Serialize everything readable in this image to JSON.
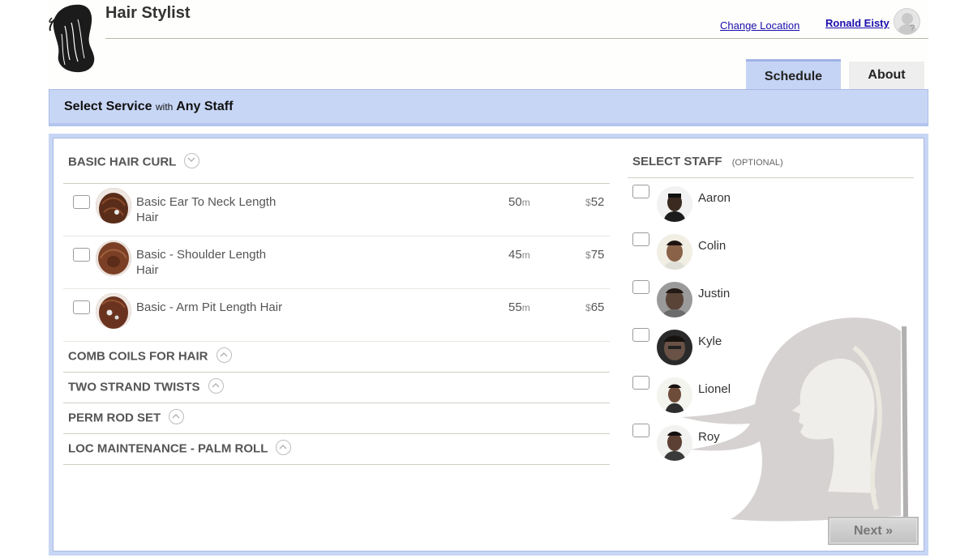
{
  "header": {
    "app_title": "Hair Stylist",
    "change_location_label": "Change Location",
    "user_name": "Ronald Eisty"
  },
  "tabs": [
    {
      "label": "Schedule",
      "active": true
    },
    {
      "label": "About",
      "active": false
    }
  ],
  "service_bar": {
    "prefix": "Select Service",
    "connector": "with",
    "staff": "Any Staff"
  },
  "categories": [
    {
      "name": "BASIC HAIR CURL",
      "expanded": true,
      "services": [
        {
          "name": "Basic Ear To Neck Length Hair",
          "duration": "50",
          "duration_unit": "m",
          "currency": "$",
          "price": "52"
        },
        {
          "name": "Basic - Shoulder Length Hair",
          "duration": "45",
          "duration_unit": "m",
          "currency": "$",
          "price": "75"
        },
        {
          "name": "Basic - Arm Pit Length Hair",
          "duration": "55",
          "duration_unit": "m",
          "currency": "$",
          "price": "65"
        }
      ]
    },
    {
      "name": "COMB COILS FOR HAIR",
      "expanded": false
    },
    {
      "name": "TWO STRAND TWISTS",
      "expanded": false
    },
    {
      "name": "PERM ROD SET",
      "expanded": false
    },
    {
      "name": "LOC MAINTENANCE - PALM ROLL",
      "expanded": false
    }
  ],
  "staff_section": {
    "title": "SELECT STAFF",
    "subtitle": "(OPTIONAL)",
    "members": [
      {
        "name": "Aaron"
      },
      {
        "name": "Colin"
      },
      {
        "name": "Justin"
      },
      {
        "name": "Kyle"
      },
      {
        "name": "Lionel"
      },
      {
        "name": "Roy"
      }
    ]
  },
  "next_button_label": "Next »",
  "colors": {
    "accent_blue": "#c8d6f6",
    "link_blue": "#1a0dab",
    "text_gray": "#555555"
  }
}
